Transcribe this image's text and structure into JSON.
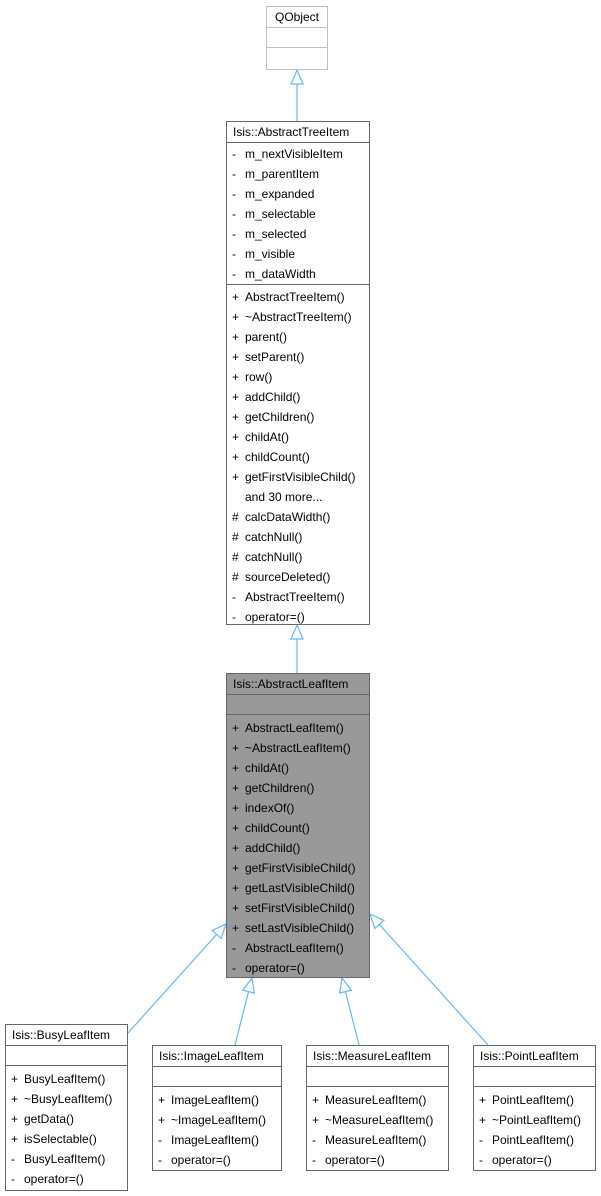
{
  "diagram": {
    "type": "class-inheritance",
    "edge_color": "#63b8ff",
    "focus_fill": "#999999",
    "nodes": {
      "qobject": {
        "title": "QObject",
        "attributes": [],
        "methods": []
      },
      "abstract_tree_item": {
        "title": "Isis::AbstractTreeItem",
        "attributes": [
          {
            "vis": "-",
            "name": "m_nextVisibleItem"
          },
          {
            "vis": "-",
            "name": "m_parentItem"
          },
          {
            "vis": "-",
            "name": "m_expanded"
          },
          {
            "vis": "-",
            "name": "m_selectable"
          },
          {
            "vis": "-",
            "name": "m_selected"
          },
          {
            "vis": "-",
            "name": "m_visible"
          },
          {
            "vis": "-",
            "name": "m_dataWidth"
          }
        ],
        "methods": [
          {
            "vis": "+",
            "name": "AbstractTreeItem()"
          },
          {
            "vis": "+",
            "name": "~AbstractTreeItem()"
          },
          {
            "vis": "+",
            "name": "parent()"
          },
          {
            "vis": "+",
            "name": "setParent()"
          },
          {
            "vis": "+",
            "name": "row()"
          },
          {
            "vis": "+",
            "name": "addChild()"
          },
          {
            "vis": "+",
            "name": "getChildren()"
          },
          {
            "vis": "+",
            "name": "childAt()"
          },
          {
            "vis": "+",
            "name": "childCount()"
          },
          {
            "vis": "+",
            "name": "getFirstVisibleChild()"
          },
          {
            "vis": "",
            "name": "and 30 more..."
          },
          {
            "vis": "#",
            "name": "calcDataWidth()"
          },
          {
            "vis": "#",
            "name": "catchNull()"
          },
          {
            "vis": "#",
            "name": "catchNull()"
          },
          {
            "vis": "#",
            "name": "sourceDeleted()"
          },
          {
            "vis": "-",
            "name": "AbstractTreeItem()"
          },
          {
            "vis": "-",
            "name": "operator=()"
          }
        ]
      },
      "abstract_leaf_item": {
        "title": "Isis::AbstractLeafItem",
        "attributes": [],
        "methods": [
          {
            "vis": "+",
            "name": "AbstractLeafItem()"
          },
          {
            "vis": "+",
            "name": "~AbstractLeafItem()"
          },
          {
            "vis": "+",
            "name": "childAt()"
          },
          {
            "vis": "+",
            "name": "getChildren()"
          },
          {
            "vis": "+",
            "name": "indexOf()"
          },
          {
            "vis": "+",
            "name": "childCount()"
          },
          {
            "vis": "+",
            "name": "addChild()"
          },
          {
            "vis": "+",
            "name": "getFirstVisibleChild()"
          },
          {
            "vis": "+",
            "name": "getLastVisibleChild()"
          },
          {
            "vis": "+",
            "name": "setFirstVisibleChild()"
          },
          {
            "vis": "+",
            "name": "setLastVisibleChild()"
          },
          {
            "vis": "-",
            "name": "AbstractLeafItem()"
          },
          {
            "vis": "-",
            "name": "operator=()"
          }
        ]
      },
      "busy_leaf_item": {
        "title": "Isis::BusyLeafItem",
        "attributes": [],
        "methods": [
          {
            "vis": "+",
            "name": "BusyLeafItem()"
          },
          {
            "vis": "+",
            "name": "~BusyLeafItem()"
          },
          {
            "vis": "+",
            "name": "getData()"
          },
          {
            "vis": "+",
            "name": "isSelectable()"
          },
          {
            "vis": "-",
            "name": "BusyLeafItem()"
          },
          {
            "vis": "-",
            "name": "operator=()"
          }
        ]
      },
      "image_leaf_item": {
        "title": "Isis::ImageLeafItem",
        "attributes": [],
        "methods": [
          {
            "vis": "+",
            "name": "ImageLeafItem()"
          },
          {
            "vis": "+",
            "name": "~ImageLeafItem()"
          },
          {
            "vis": "-",
            "name": "ImageLeafItem()"
          },
          {
            "vis": "-",
            "name": "operator=()"
          }
        ]
      },
      "measure_leaf_item": {
        "title": "Isis::MeasureLeafItem",
        "attributes": [],
        "methods": [
          {
            "vis": "+",
            "name": "MeasureLeafItem()"
          },
          {
            "vis": "+",
            "name": "~MeasureLeafItem()"
          },
          {
            "vis": "-",
            "name": "MeasureLeafItem()"
          },
          {
            "vis": "-",
            "name": "operator=()"
          }
        ]
      },
      "point_leaf_item": {
        "title": "Isis::PointLeafItem",
        "attributes": [],
        "methods": [
          {
            "vis": "+",
            "name": "PointLeafItem()"
          },
          {
            "vis": "+",
            "name": "~PointLeafItem()"
          },
          {
            "vis": "-",
            "name": "PointLeafItem()"
          },
          {
            "vis": "-",
            "name": "operator=()"
          }
        ]
      }
    },
    "edges": [
      {
        "from": "abstract_tree_item",
        "to": "qobject",
        "kind": "inherits"
      },
      {
        "from": "abstract_leaf_item",
        "to": "abstract_tree_item",
        "kind": "inherits"
      },
      {
        "from": "busy_leaf_item",
        "to": "abstract_leaf_item",
        "kind": "inherits"
      },
      {
        "from": "image_leaf_item",
        "to": "abstract_leaf_item",
        "kind": "inherits"
      },
      {
        "from": "measure_leaf_item",
        "to": "abstract_leaf_item",
        "kind": "inherits"
      },
      {
        "from": "point_leaf_item",
        "to": "abstract_leaf_item",
        "kind": "inherits"
      }
    ]
  }
}
